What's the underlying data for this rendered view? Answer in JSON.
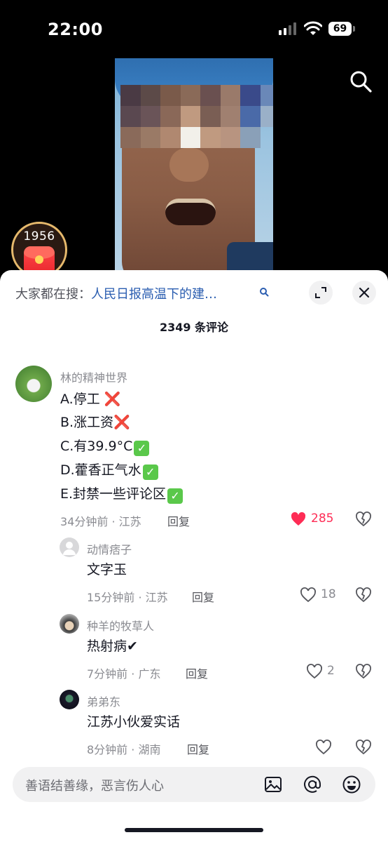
{
  "status_bar": {
    "time": "22:00",
    "battery": "69"
  },
  "badge": {
    "number": "1956"
  },
  "panel": {
    "search_prefix": "大家都在搜：",
    "search_query": "人民日报高温下的建…",
    "count": "2349 条评论"
  },
  "comments": [
    {
      "user": "林的精神世界",
      "lines": [
        "A.停工",
        "B.涨工资",
        "C.有39.9°C",
        "D.藿香正气水",
        "E.封禁一些评论区"
      ],
      "line_marks": [
        "❌",
        "❌",
        "✅",
        "✅",
        "✅"
      ],
      "meta": "34分钟前 · 江苏",
      "reply": "回复",
      "likes": "285"
    }
  ],
  "replies": [
    {
      "user": "动情痞子",
      "text": "文字玉",
      "meta": "15分钟前 · 江苏",
      "reply": "回复",
      "likes": "18"
    },
    {
      "user": "种羊的牧草人",
      "text": "热射病✔",
      "meta": "7分钟前 · 广东",
      "reply": "回复",
      "likes": "2"
    },
    {
      "user": "弟弟东",
      "text": "江苏小伙爱实话",
      "meta": "8分钟前 · 湖南",
      "reply": "回复",
      "likes": ""
    }
  ],
  "input": {
    "placeholder": "善语结善缘，恶言伤人心"
  },
  "colors": {
    "accent": "#fe2c55",
    "link": "#2a5db0",
    "muted": "#8a8b91"
  },
  "icons": [
    "search-icon",
    "expand-icon",
    "close-icon",
    "heart-icon",
    "broken-heart-icon",
    "image-icon",
    "at-icon",
    "emoji-icon"
  ]
}
